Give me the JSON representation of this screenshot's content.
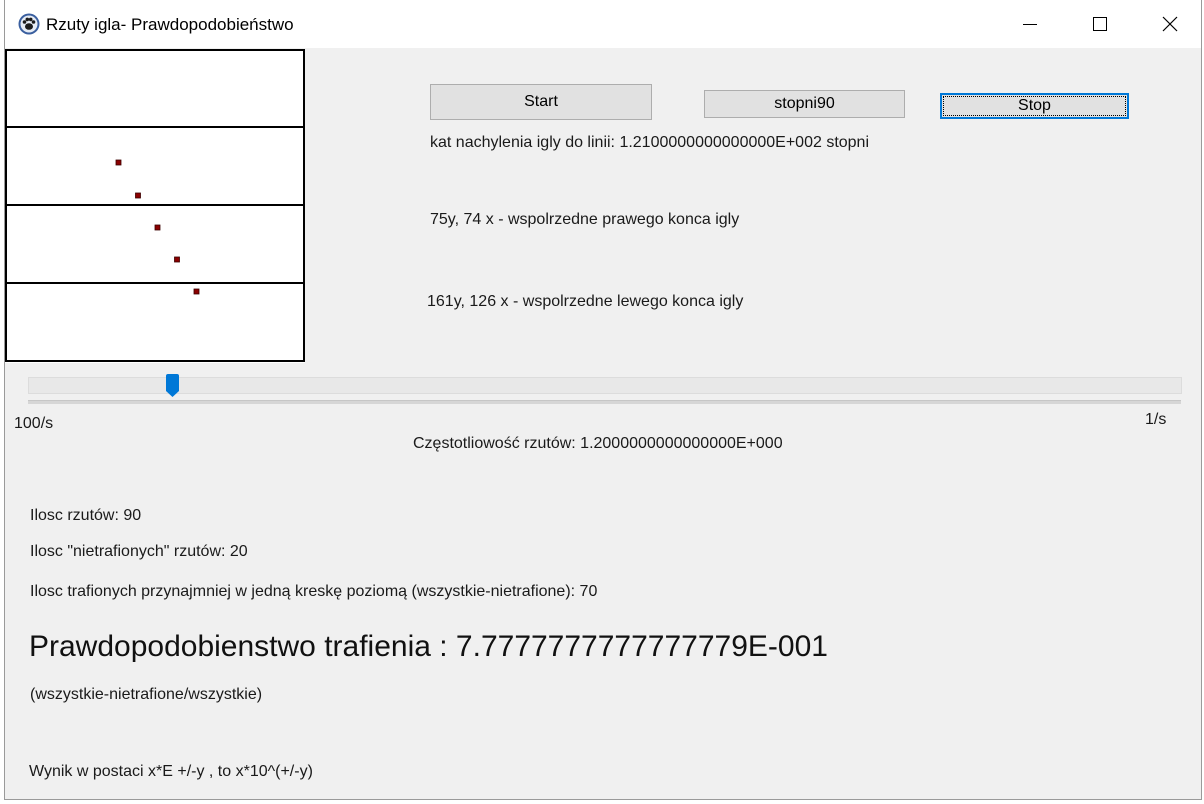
{
  "window": {
    "title": "Rzuty igla- Prawdopodobieństwo"
  },
  "controls": {
    "start_label": "Start",
    "deg90_label": "stopni90",
    "stop_label": "Stop"
  },
  "info": {
    "angle_text": "kat nachylenia igly do linii:  1.2100000000000000E+002 stopni",
    "right_end_text": "75y, 74 x - wspolrzedne prawego konca igly",
    "left_end_text": "161y, 126 x - wspolrzedne lewego konca igly"
  },
  "slider": {
    "min_label": "100/s",
    "max_label": "1/s",
    "value": 0.125,
    "frequency_text": "Częstotliowość rzutów:  1.2000000000000000E+000"
  },
  "stats": {
    "count_text": "Ilosc rzutów: 90",
    "miss_text": "Ilosc \"nietrafionych\" rzutów: 20",
    "hit_text": "Ilosc trafionych przynajmniej w jedną kreskę poziomą (wszystkie-nietrafione): 70",
    "probability_text": "Prawdopodobienstwo trafienia :  7.7777777777777779E-001",
    "formula_text": "(wszystkie-nietrafione/wszystkie)",
    "note_text": "Wynik w postaci x*E +/-y , to x*10^(+/-y)"
  },
  "colors": {
    "accent": "#0078d7",
    "needle_point": "#8b0000",
    "board_lines": "#000000"
  },
  "icons": {
    "app": "paw-icon",
    "minimize": "minimize-icon",
    "maximize": "maximize-icon",
    "close": "close-icon"
  }
}
